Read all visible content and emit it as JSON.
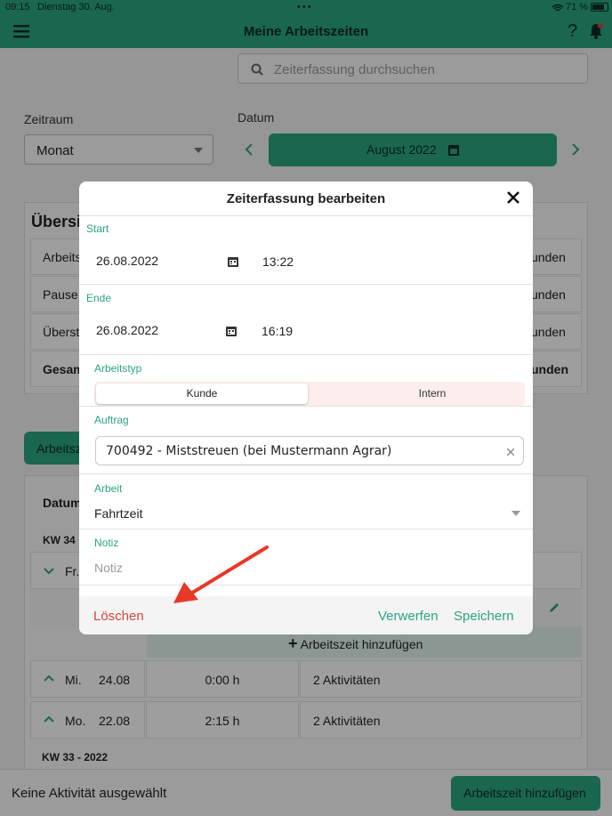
{
  "status_bar": {
    "time": "09:15",
    "date": "Dienstag 30. Aug.",
    "battery": "71 %"
  },
  "header": {
    "title": "Meine Arbeitszeiten"
  },
  "search": {
    "placeholder": "Zeiterfassung durchsuchen"
  },
  "filters": {
    "zeitraum_label": "Zeitraum",
    "zeitraum_value": "Monat",
    "datum_label": "Datum",
    "datum_value": "August 2022"
  },
  "overview": {
    "title": "Übersi",
    "rows": [
      {
        "label": "Arbeits",
        "value": "unden"
      },
      {
        "label": "Pause",
        "value": "unden"
      },
      {
        "label": "Überst",
        "value": "unden"
      },
      {
        "label": "Gesam",
        "value": "unden"
      }
    ]
  },
  "tab_partial": "Arbeitsz",
  "list": {
    "header_datum": "Datum",
    "week_34": "KW 34",
    "fri_label": "Fr.",
    "add_time_label": "Arbeitszeit hinzufügen",
    "rows": [
      {
        "day": "Mi.",
        "date": "24.08",
        "hours": "0:00 h",
        "activities": "2 Aktivitäten"
      },
      {
        "day": "Mo.",
        "date": "22.08",
        "hours": "2:15 h",
        "activities": "2 Aktivitäten"
      }
    ],
    "week_33": "KW 33 - 2022"
  },
  "bottom_bar": {
    "status": "Keine Aktivität ausgewählt",
    "add_button": "Arbeitszeit hinzufügen"
  },
  "modal": {
    "title": "Zeiterfassung bearbeiten",
    "start_label": "Start",
    "start_date": "26.08.2022",
    "start_time": "13:22",
    "end_label": "Ende",
    "end_date": "26.08.2022",
    "end_time": "16:19",
    "worktype_label": "Arbeitstyp",
    "worktype_options": [
      "Kunde",
      "Intern"
    ],
    "worktype_selected": "Kunde",
    "order_label": "Auftrag",
    "order_value": "700492 - Miststreuen (bei Mustermann Agrar)",
    "work_label": "Arbeit",
    "work_value": "Fahrtzeit",
    "note_label": "Notiz",
    "note_placeholder": "Notiz",
    "delete_label": "Löschen",
    "discard_label": "Verwerfen",
    "save_label": "Speichern"
  },
  "colors": {
    "accent": "#2aa584",
    "danger": "#d9473a",
    "arrow": "#e8382a"
  }
}
